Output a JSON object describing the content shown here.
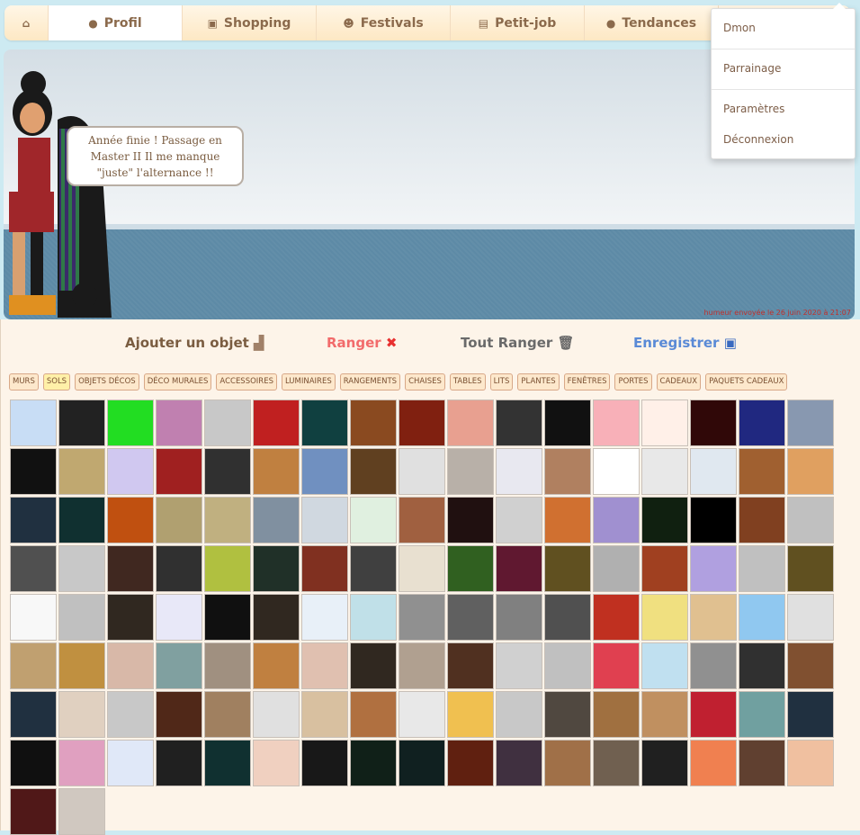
{
  "nav": {
    "items": [
      {
        "label": "",
        "icon": "home-icon",
        "glyph": "⌂"
      },
      {
        "label": "Profil",
        "icon": "user-icon",
        "glyph": "●"
      },
      {
        "label": "Shopping",
        "icon": "shopping-bag-icon",
        "glyph": "▣"
      },
      {
        "label": "Festivals",
        "icon": "users-icon",
        "glyph": "☻"
      },
      {
        "label": "Petit-job",
        "icon": "briefcase-icon",
        "glyph": "▤"
      },
      {
        "label": "Tendances",
        "icon": "comments-icon",
        "glyph": "●"
      }
    ],
    "active": 1
  },
  "dropdown": {
    "items": [
      "Dmon",
      "Parrainage",
      "Paramètres",
      "Déconnexion"
    ]
  },
  "scene": {
    "speech": [
      "Année finie ! Passage en",
      "Master II Il me manque",
      "\"juste\" l'alternance !!"
    ],
    "timestamp": "humeur envoyée le 26 juin 2020 à 21:07"
  },
  "actions": {
    "add": "Ajouter un objet",
    "store": "Ranger",
    "store_all": "Tout Ranger",
    "save": "Enregistrer"
  },
  "colors": {
    "add": "#7a5c40",
    "store": "#f26b6b",
    "store_all": "#6a6a6a",
    "save": "#5a8ad6"
  },
  "categories": [
    "MURS",
    "SOLS",
    "OBJETS DÉCOS",
    "DÉCO MURALES",
    "ACCESSOIRES",
    "LUMINAIRES",
    "RANGEMENTS",
    "CHAISES",
    "TABLES",
    "LITS",
    "PLANTES",
    "FENÊTRES",
    "PORTES",
    "CADEAUX",
    "PAQUETS CADEAUX"
  ],
  "active_category": "SOLS",
  "tiles": [
    "#c8ddf5",
    "#222222",
    "#22dd22",
    "#c080b0",
    "#c8c8c8",
    "#c02020",
    "#104040",
    "#8a4a20",
    "#802010",
    "#e8a090",
    "#333333",
    "#111111",
    "#f8b0b8",
    "#fff0e8",
    "#300808",
    "#202880",
    "#8898b0",
    "#111111",
    "#c0a870",
    "#d0c8f0",
    "#a02020",
    "#303030",
    "#c08040",
    "#7090c0",
    "#604020",
    "#e0e0e0",
    "#b8b0a8",
    "#e8e8f0",
    "#b08060",
    "#ffffff",
    "#e8e8e8",
    "#e0e8f0",
    "#a06030",
    "#e0a060",
    "#203040",
    "#103030",
    "#c05010",
    "#b0a070",
    "#c0b080",
    "#8090a0",
    "#d0d8e0",
    "#e0f0e0",
    "#a06040",
    "#201010",
    "#d0d0d0",
    "#d07030",
    "#a090d0",
    "#102010",
    "#000000",
    "#804020",
    "#c0c0c0",
    "#505050",
    "#c8c8c8",
    "#402820",
    "#303030",
    "#b0c040",
    "#203028",
    "#803020",
    "#404040",
    "#e8e0d0",
    "#306020",
    "#601830",
    "#605020",
    "#b0b0b0",
    "#a04020",
    "#b0a0e0",
    "#c0c0c0",
    "#605020",
    "#f8f8f8",
    "#c0c0c0",
    "#302820",
    "#e8e8f8",
    "#101010",
    "#302820",
    "#e8f0f8",
    "#c0e0e8",
    "#909090",
    "#606060",
    "#808080",
    "#505050",
    "#c03020",
    "#f0e080",
    "#e0c090",
    "#90c8f0",
    "#e0e0e0",
    "#c0a070",
    "#c09040",
    "#d8b8a8",
    "#80a0a0",
    "#a09080",
    "#c08040",
    "#e0c0b0",
    "#302820",
    "#b0a090",
    "#503020",
    "#d0d0d0",
    "#c0c0c0",
    "#e04050",
    "#c0e0f0",
    "#909090",
    "#303030",
    "#805030",
    "#203040",
    "#e0d0c0",
    "#c8c8c8",
    "#502818",
    "#a08060",
    "#e0e0e0",
    "#d8c0a0",
    "#b07040",
    "#e8e8e8",
    "#f0c050",
    "#c8c8c8",
    "#504840",
    "#a07040",
    "#c09060",
    "#c02030",
    "#70a0a0",
    "#203040",
    "#101010",
    "#e0a0c0",
    "#e0e8f8",
    "#202020",
    "#103030",
    "#f0d0c0",
    "#181818",
    "#102018",
    "#102020",
    "#602010",
    "#403040",
    "#a07048",
    "#706050",
    "#202020",
    "#f08050",
    "#604030",
    "#f0c0a0",
    "#501818",
    "#d0c8c0"
  ]
}
